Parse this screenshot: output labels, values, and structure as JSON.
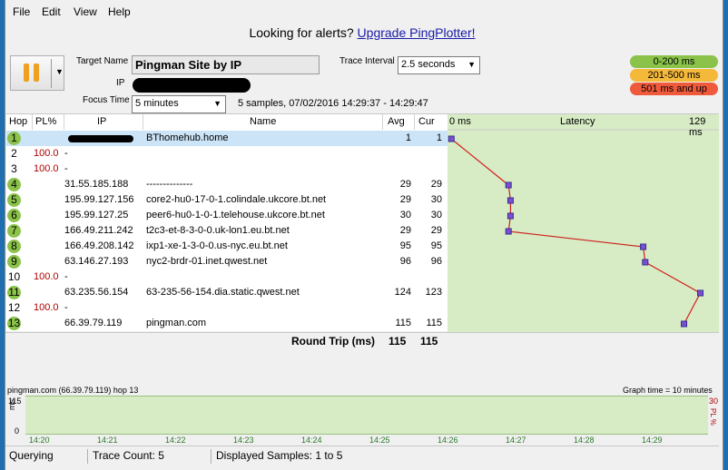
{
  "menu": [
    "File",
    "Edit",
    "View",
    "Help"
  ],
  "banner": {
    "text": "Looking for alerts? ",
    "link": "Upgrade PingPlotter!"
  },
  "form": {
    "target_label": "Target Name",
    "target_value": "Pingman Site by IP",
    "ip_label": "IP",
    "focus_label": "Focus Time",
    "focus_value": "5 minutes",
    "interval_label": "Trace Interval",
    "interval_value": "2.5 seconds",
    "samples_text": "5 samples, 07/02/2016 14:29:37 - 14:29:47"
  },
  "legend": [
    {
      "label": "0-200 ms",
      "color": "#8bc34a"
    },
    {
      "label": "201-500 ms",
      "color": "#f5b93a"
    },
    {
      "label": "501 ms and up",
      "color": "#f05a3c"
    }
  ],
  "table": {
    "headers": {
      "hop": "Hop",
      "pl": "PL%",
      "ip": "IP",
      "name": "Name",
      "avg": "Avg",
      "cur": "Cur",
      "latency": "Latency"
    },
    "latency_min": "0 ms",
    "latency_max": "129 ms",
    "rows": [
      {
        "hop": "1",
        "pl": "",
        "ip": "",
        "name": "BThomehub.home",
        "avg": "1",
        "cur": "1"
      },
      {
        "hop": "2",
        "pl": "100.0",
        "ip": "-",
        "name": "",
        "avg": "",
        "cur": ""
      },
      {
        "hop": "3",
        "pl": "100.0",
        "ip": "-",
        "name": "",
        "avg": "",
        "cur": ""
      },
      {
        "hop": "4",
        "pl": "",
        "ip": "31.55.185.188",
        "name": "--------------",
        "avg": "29",
        "cur": "29"
      },
      {
        "hop": "5",
        "pl": "",
        "ip": "195.99.127.156",
        "name": "core2-hu0-17-0-1.colindale.ukcore.bt.net",
        "avg": "29",
        "cur": "30"
      },
      {
        "hop": "6",
        "pl": "",
        "ip": "195.99.127.25",
        "name": "peer6-hu0-1-0-1.telehouse.ukcore.bt.net",
        "avg": "30",
        "cur": "30"
      },
      {
        "hop": "7",
        "pl": "",
        "ip": "166.49.211.242",
        "name": "t2c3-et-8-3-0-0.uk-lon1.eu.bt.net",
        "avg": "29",
        "cur": "29"
      },
      {
        "hop": "8",
        "pl": "",
        "ip": "166.49.208.142",
        "name": "ixp1-xe-1-3-0-0.us-nyc.eu.bt.net",
        "avg": "95",
        "cur": "95"
      },
      {
        "hop": "9",
        "pl": "",
        "ip": "63.146.27.193",
        "name": "nyc2-brdr-01.inet.qwest.net",
        "avg": "96",
        "cur": "96"
      },
      {
        "hop": "10",
        "pl": "100.0",
        "ip": "-",
        "name": "",
        "avg": "",
        "cur": ""
      },
      {
        "hop": "11",
        "pl": "",
        "ip": "63.235.56.154",
        "name": "63-235-56-154.dia.static.qwest.net",
        "avg": "124",
        "cur": "123"
      },
      {
        "hop": "12",
        "pl": "100.0",
        "ip": "-",
        "name": "",
        "avg": "",
        "cur": ""
      },
      {
        "hop": "13",
        "pl": "",
        "ip": "66.39.79.119",
        "name": "pingman.com",
        "avg": "115",
        "cur": "115"
      }
    ],
    "roundtrip_label": "Round Trip (ms)",
    "roundtrip_avg": "115",
    "roundtrip_cur": "115"
  },
  "timeline": {
    "title": "pingman.com (66.39.79.119) hop 13",
    "graph_time": "Graph time = 10 minutes",
    "y_max": "115",
    "y_unit": "ms",
    "y_zero": "0",
    "pl_max": "30",
    "pl_label": "PL %",
    "ticks": [
      "14:20",
      "14:21",
      "14:22",
      "14:23",
      "14:24",
      "14:25",
      "14:26",
      "14:27",
      "14:28",
      "14:29"
    ]
  },
  "status": {
    "state": "Querying",
    "trace_count": "Trace Count: 5",
    "displayed": "Displayed Samples: 1 to 5"
  }
}
